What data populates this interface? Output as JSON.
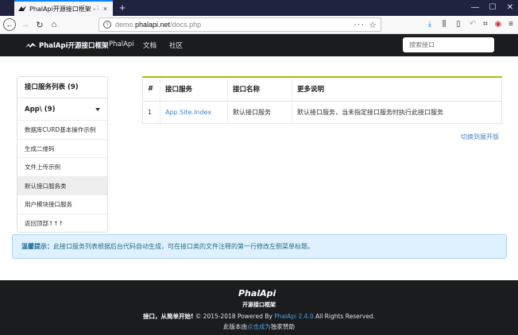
{
  "browser": {
    "tab_title": "PhalApi开源接口框架 - 在线接",
    "tab_close": "×",
    "new_tab": "+",
    "url_prefix": "demo.",
    "url_domain": "phalapi.net",
    "url_suffix": "/docs.php",
    "url_menu": "···",
    "minimize": "—",
    "maximize": "☐",
    "close": "✕"
  },
  "header": {
    "brand": "PhalApi开源接口框架",
    "menu": [
      "PhalApi",
      "文档",
      "社区"
    ],
    "search_placeholder": "搜索接口"
  },
  "sidebar": {
    "title": "接口服务列表 (9)",
    "group": "App\\ (9)",
    "items": [
      "数据库CURD基本操作示例",
      "生成二维码",
      "文件上传示例",
      "默认接口服务类",
      "用户模块接口服务",
      "返回顶部↑↑↑"
    ],
    "active_index": 3
  },
  "table": {
    "headers": [
      "#",
      "接口服务",
      "接口名称",
      "更多说明"
    ],
    "rows": [
      {
        "num": "1",
        "service": "App.Site.Index",
        "name": "默认接口服务",
        "desc": "默认接口服务，当未指定接口服务时执行此接口服务"
      }
    ]
  },
  "toggle_label": "切换到展开版",
  "tip": {
    "label": "温馨提示：",
    "text": "此接口服务列表根据后台代码自动生成，可在接口类的文件注释的第一行修改左侧菜单标题。"
  },
  "footer": {
    "logo_text": "PhalApi",
    "slogan": "开源接口框架",
    "line1_bold": "接口，从简单开始!",
    "line1_text": " © 2015-2018 Powered By ",
    "line1_link": "PhalApi 2.4.0",
    "line1_tail": " All Rights Reserved.",
    "line2_pre": "此版本由",
    "line2_link": "点击成为",
    "line2_post": "独家赞助"
  },
  "colors": {
    "accent_green": "#a3c20a",
    "link_blue": "#4183c4",
    "header_dark": "#1b1c1d",
    "tab_blue": "#0a84ff"
  }
}
